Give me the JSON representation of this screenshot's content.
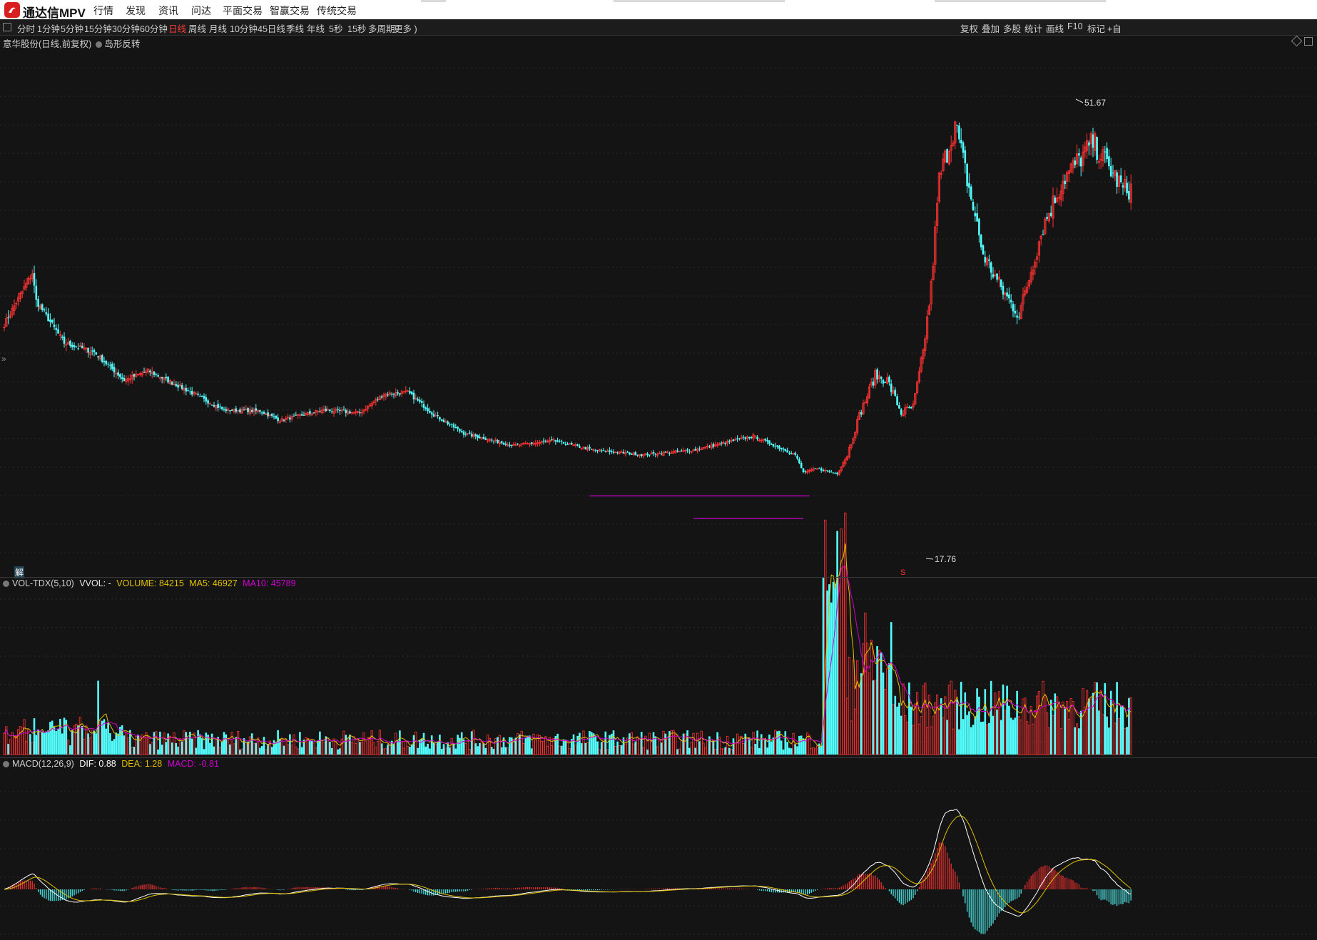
{
  "app": {
    "name": "通达信MPV",
    "menu": [
      "行情",
      "发现",
      "资讯",
      "问达",
      "平面交易",
      "智赢交易",
      "传统交易"
    ]
  },
  "periods": {
    "items": [
      "分时",
      "1分钟",
      "5分钟",
      "15分钟",
      "30分钟",
      "60分钟",
      "日线",
      "周线",
      "月线",
      "10分钟",
      "45日线",
      "季线",
      "年线",
      "5秒",
      "15秒",
      "多周期",
      "更多 )"
    ],
    "active": "日线"
  },
  "tools": [
    "复权",
    "叠加",
    "多股",
    "统计",
    "画线",
    "F10",
    "标记",
    "+自"
  ],
  "stock": {
    "title": "意华股份(日线,前复权)",
    "indicator": "岛形反转"
  },
  "price_marks": {
    "high": "51.67",
    "low": "17.76",
    "jie_badge": "解",
    "s_marker": "S"
  },
  "vol_legend": {
    "name": "VOL-TDX(5,10)",
    "vvol": "VVOL: -",
    "volume": "VOLUME: 84215",
    "ma5": "MA5: 46927",
    "ma10": "MA10: 45789"
  },
  "macd_legend": {
    "name": "MACD(12,26,9)",
    "dif": "DIF: 0.88",
    "dea": "DEA: 1.28",
    "macd": "MACD: -0.81"
  },
  "colors": {
    "up": "#ff3232",
    "down": "#54ffff",
    "ma5": "#e0c000",
    "ma10": "#d000d0",
    "dif": "#ffffff",
    "dea": "#e0c000",
    "island": "#d000d0",
    "bg": "#141414"
  },
  "chart_data": {
    "type": "candlestick",
    "anchors_price": [
      [
        0,
        24.5
      ],
      [
        14,
        30.0
      ],
      [
        16,
        27.0
      ],
      [
        30,
        22.5
      ],
      [
        45,
        21.5
      ],
      [
        60,
        18.5
      ],
      [
        72,
        19.5
      ],
      [
        88,
        17.8
      ],
      [
        110,
        15.3
      ],
      [
        128,
        15.2
      ],
      [
        138,
        14.2
      ],
      [
        160,
        15.3
      ],
      [
        178,
        15.0
      ],
      [
        190,
        17.0
      ],
      [
        202,
        17.2
      ],
      [
        215,
        14.8
      ],
      [
        230,
        12.8
      ],
      [
        255,
        11.5
      ],
      [
        275,
        12.0
      ],
      [
        295,
        11.0
      ],
      [
        320,
        10.5
      ],
      [
        345,
        11.0
      ],
      [
        375,
        12.5
      ],
      [
        396,
        10.5
      ],
      [
        400,
        8.6
      ],
      [
        407,
        9.0
      ],
      [
        417,
        8.5
      ],
      [
        422,
        10.5
      ],
      [
        428,
        14.7
      ],
      [
        436,
        19.0
      ],
      [
        442,
        18.5
      ],
      [
        449,
        15.0
      ],
      [
        455,
        15.6
      ],
      [
        460,
        21.5
      ],
      [
        464,
        28.5
      ],
      [
        468,
        40.0
      ],
      [
        476,
        46.0
      ],
      [
        480,
        42.0
      ],
      [
        490,
        32.0
      ],
      [
        500,
        28.0
      ],
      [
        508,
        25.5
      ],
      [
        520,
        35.0
      ],
      [
        530,
        40.0
      ],
      [
        545,
        44.0
      ],
      [
        560,
        39.0
      ]
    ],
    "high": 51.67,
    "low": 17.76,
    "island": {
      "upper_line": {
        "from": 293,
        "to": 403,
        "price": 6.1
      },
      "lower_line": {
        "from": 345,
        "to": 400,
        "price": 3.7
      }
    }
  }
}
